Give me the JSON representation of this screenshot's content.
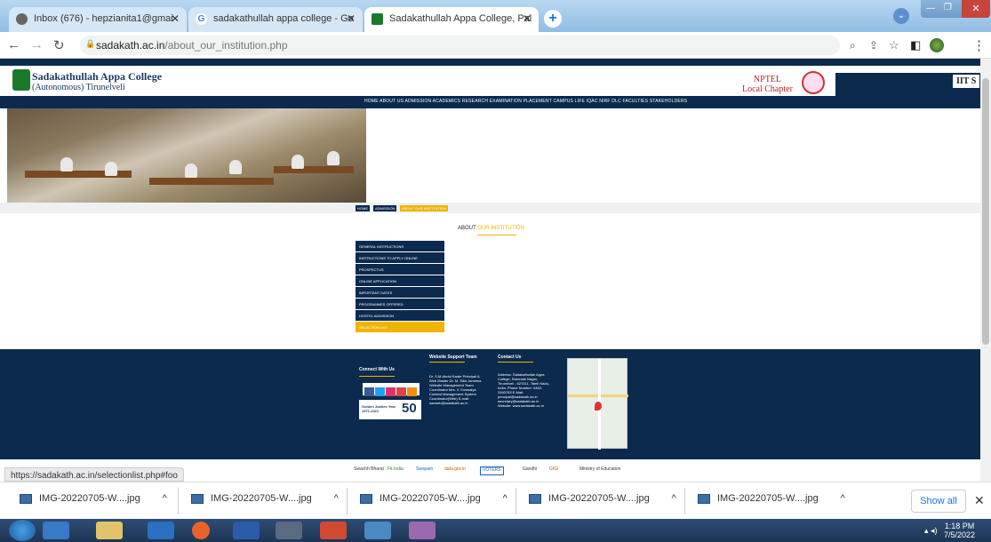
{
  "browser": {
    "tabs": [
      {
        "title": "Inbox (676) - hepzianita1@gmai"
      },
      {
        "title": "sadakathullah appa college - Go"
      },
      {
        "title": "Sadakathullah Appa College, Pal"
      }
    ],
    "url_domain": "sadakath.ac.in",
    "url_path": "/about_our_institution.php",
    "status_url": "https://sadakath.ac.in/selectionlist.php#foo"
  },
  "site": {
    "college_name": "Sadakathullah Appa College",
    "college_sub": "(Autonomous) Tirunelveli",
    "nptel_line1": "NPTEL",
    "nptel_line2": "Local Chapter",
    "partner": "IIT S",
    "menu": "HOME   ABOUT US   ADMISSION   ACADEMICS   RESEARCH   EXAMINATION   PLACEMENT   CAMPUS LIFE   IQAC   NIRF   DLC   FACULTIES   STAKEHOLDERS",
    "breadcrumb": [
      "HOME",
      "ADMISSION",
      "ABOUT OUR INSTITUTION"
    ],
    "heading_prefix": "ABOUT",
    "heading_highlight": "OUR INSTITUTION",
    "side_menu": [
      "GENERAL INSTRUCTIONS",
      "INSTRUCTIONS TO APPLY ONLINE",
      "PROSPECTUS",
      "ONLINE APPLICATION",
      "IMPORTANT DATES",
      "PROGRAMMES OFFERED",
      "HOSTEL ADMISSION",
      "SELECTION LIST"
    ],
    "footer": {
      "connect_title": "Connect With Us",
      "team_title": "Website Support Team",
      "team_text": "Dr. S.M.Abdul Kader Principal & Web Master  Dr. M. Sikh Jameela Website Management Team Coordinator  Mrs. V. Kowsalya Content Management System Coordinator(Web)  E-mail: sacweb@sadakath.ac.in",
      "contact_title": "Contact Us",
      "contact_text": "Address: Sadakathullah Appa College, Rahmath Nagar, Tirunelveli - 627011, Tamil Nadu, India.  Phone Number: 0462-2540763  E-Mail: principal@sadakath.ac.in  secretary@sadakath.ac.in  Website: www.sadakath.ac.in",
      "jubilee": "Golden Jubilee Year 1971-2021",
      "jubilee_num": "50"
    },
    "partners": [
      "Swachh Bharat",
      "Fit India",
      "Swayam",
      "data.gov.in",
      "VOTERS",
      "Gandhi",
      "GIGI",
      "Ministry of Education"
    ]
  },
  "downloads": [
    {
      "name": "IMG-20220705-W....jpg"
    },
    {
      "name": "IMG-20220705-W....jpg"
    },
    {
      "name": "IMG-20220705-W....jpg"
    },
    {
      "name": "IMG-20220705-W....jpg"
    },
    {
      "name": "IMG-20220705-W....jpg"
    }
  ],
  "show_all": "Show all",
  "clock": {
    "time": "1:18 PM",
    "date": "7/5/2022"
  },
  "colors": {
    "navy": "#0b2a4e",
    "accent": "#f0b400",
    "green": "#1b7a2a"
  }
}
